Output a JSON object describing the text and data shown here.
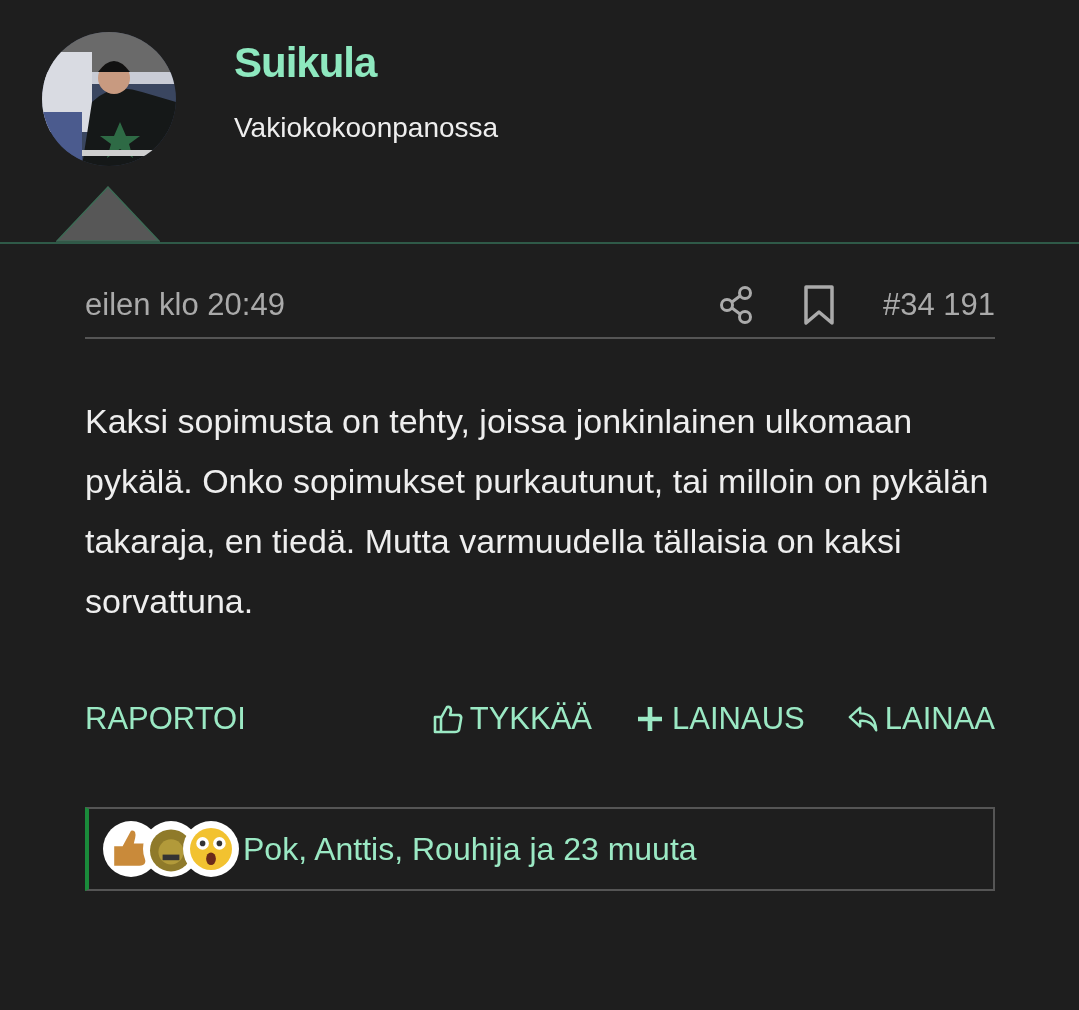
{
  "author": {
    "name": "Suikula",
    "title": "Vakiokokoonpanossa"
  },
  "meta": {
    "time": "eilen klo 20:49",
    "post_number": "#34 191"
  },
  "body": "Kaksi sopimusta on tehty, joissa jonkinlainen ulkomaan pykälä. Onko sopimukset purkautunut, tai milloin on pykälän takaraja, en tiedä. Mutta varmuudella tällaisia on kaksi sorvattuna.",
  "actions": [
    {
      "label": "RAPORTOI",
      "kind": "report"
    },
    {
      "label": "TYKKÄÄ",
      "kind": "like"
    },
    {
      "label": "LAINAUS",
      "kind": "multiquote"
    },
    {
      "label": "LAINAA",
      "kind": "reply"
    }
  ],
  "reactions": {
    "text": "Pok, Anttis, Rouhija ja 23 muuta"
  }
}
